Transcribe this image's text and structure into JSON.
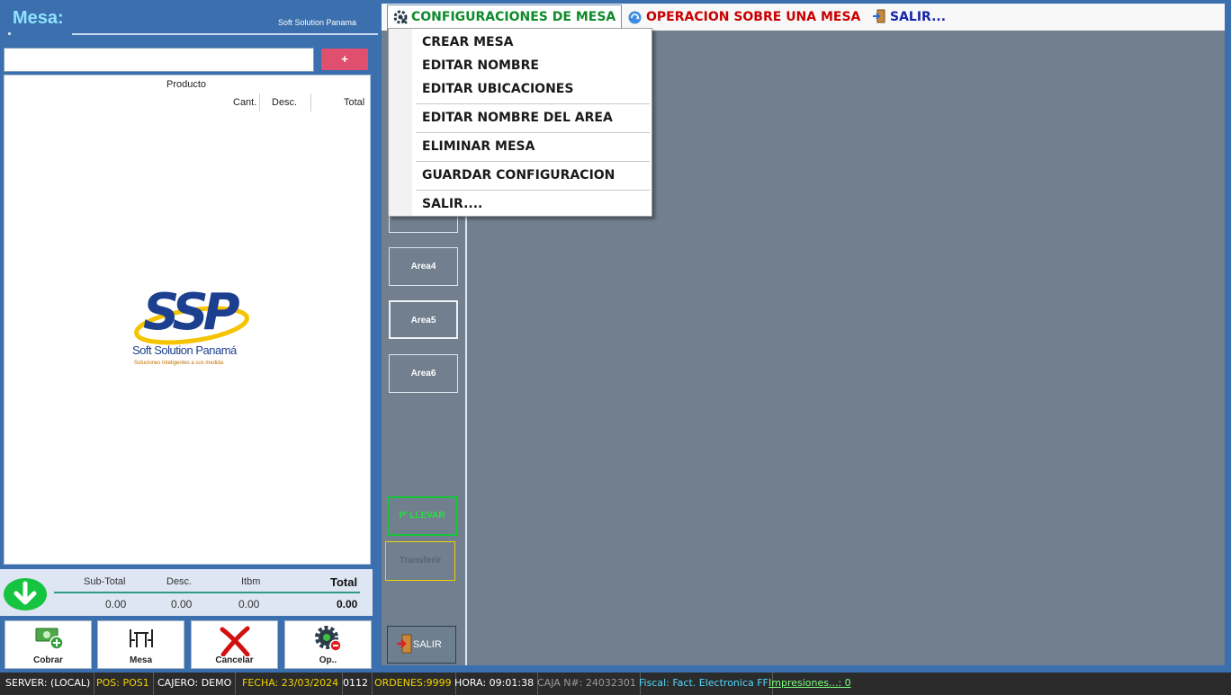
{
  "left": {
    "title": "Mesa:",
    "brand": "Soft Solution Panama",
    "product_input_value": "",
    "add_button": "+",
    "columns": {
      "producto": "Producto",
      "cant": "Cant.",
      "desc": "Desc.",
      "total": "Total"
    },
    "logo": {
      "letters": "SSP",
      "name": "Soft Solution Panamá",
      "tagline": "Soluciones Inteligentes a sus medida"
    },
    "totals": {
      "subtotal_label": "Sub-Total",
      "subtotal": "0.00",
      "desc_label": "Desc.",
      "desc": "0.00",
      "itbm_label": "Itbm",
      "itbm": "0.00",
      "total_label": "Total",
      "total": "0.00"
    },
    "actions": {
      "cobrar": "Cobrar",
      "mesa": "Mesa",
      "cancelar": "Cancelar",
      "op": "Op.."
    }
  },
  "menu": {
    "config": "CONFIGURACIONES DE MESA",
    "operacion": "OPERACION SOBRE UNA MESA",
    "salir": "SALIR..."
  },
  "dropdown": {
    "items": [
      "CREAR MESA",
      "EDITAR NOMBRE",
      "EDITAR UBICACIONES",
      "EDITAR NOMBRE DEL AREA",
      "ELIMINAR MESA",
      "GUARDAR CONFIGURACION",
      "SALIR...."
    ]
  },
  "areas": {
    "buttons": [
      "Area4",
      "Area5",
      "Area6"
    ],
    "llevar": "P' LLEVAR",
    "transferir": "Transferir",
    "salir": "SALIR"
  },
  "status": {
    "server": "SERVER: (LOCAL)",
    "pos": "POS: POS1",
    "cajero": "CAJERO: DEMO",
    "fecha": "FECHA: 23/03/2024",
    "code": "0112",
    "ordenes": "ORDENES:9999",
    "hora": "HORA: 09:01:38",
    "caja": "CAJA N#: 24032301",
    "fiscal": "Fiscal: Fact. Electronica FF",
    "impresiones": "Impresiones...: 0"
  },
  "colors": {
    "panel_blue": "#3b6fae",
    "config_green": "#0d8a2a",
    "oper_red": "#c80000",
    "salir_blue": "#1524a8",
    "canvas_gray": "#717f8e",
    "status_yellow": "#f2d200",
    "status_cyan": "#4fd9ff",
    "status_green": "#7dff7d"
  }
}
